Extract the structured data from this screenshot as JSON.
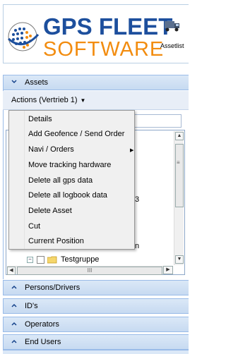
{
  "logo": {
    "top": "GPS FLEET",
    "bottom": "SOFTWARE"
  },
  "header": {
    "assetlist_link": "Assetlist"
  },
  "assets_panel": {
    "title": "Assets",
    "actions_label": "Actions (Vertrieb 1)",
    "tree": {
      "visible_row_label": "Testgruppe",
      "partial_texts": [
        "3",
        "n"
      ]
    }
  },
  "context_menu": {
    "items": [
      "Details",
      "Add Geofence / Send Order",
      "Navi / Orders",
      "Move tracking hardware",
      "Delete all gps data",
      "Delete all logbook data",
      "Delete Asset",
      "Cut",
      "Current Position"
    ]
  },
  "accordion": {
    "sections": [
      "Persons/Drivers",
      "ID's",
      "Operators",
      "End Users"
    ]
  },
  "colors": {
    "logo_blue": "#1d4f9d",
    "logo_orange": "#f28c0f",
    "panel_header": "#c7daf1",
    "panel_border": "#99bbe8"
  },
  "icons": {
    "header_logo": "globe-icon",
    "truck": "truck-icon",
    "expand": "chevron-down-icon",
    "collapse": "chevron-up-icon",
    "tree_folder": "folder-icon"
  }
}
